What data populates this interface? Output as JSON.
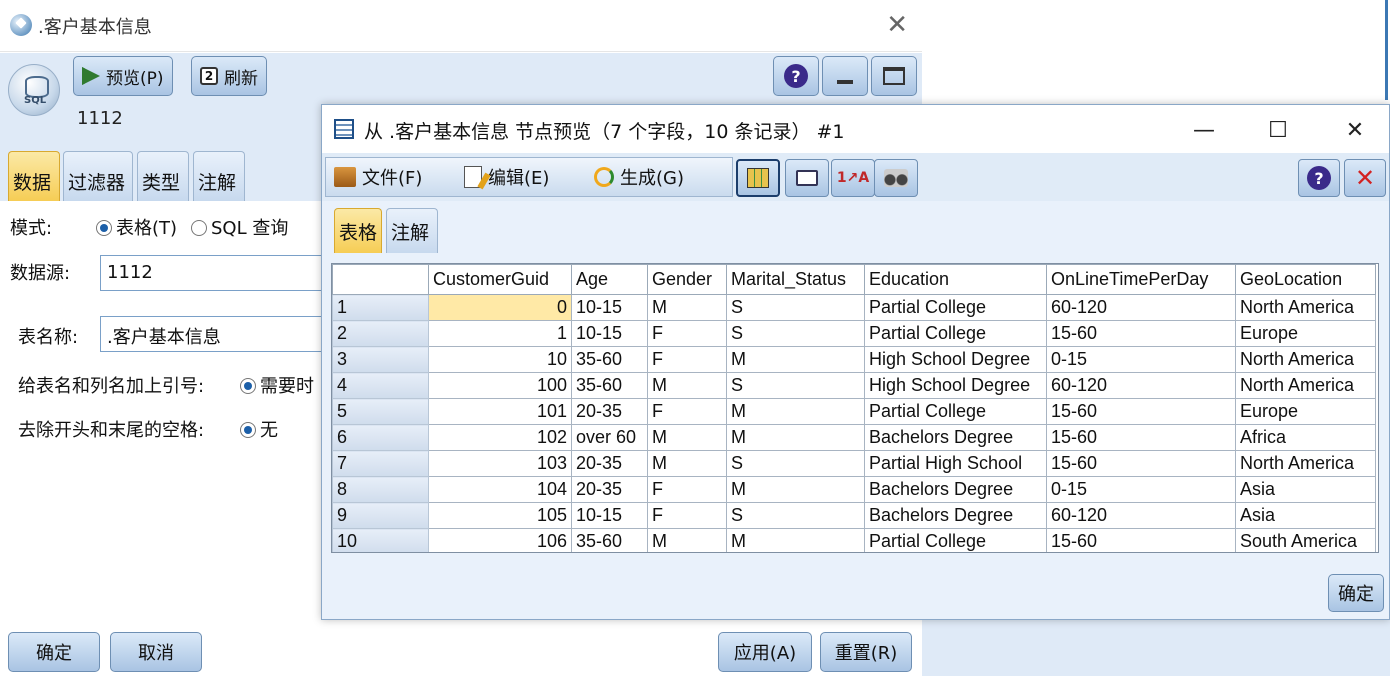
{
  "back_dialog": {
    "title": ".客户基本信息",
    "toolbar": {
      "preview_label": "预览(P)",
      "refresh_label": "刷新"
    },
    "source_name": "1112",
    "tabs": [
      "数据",
      "过滤器",
      "类型",
      "注解"
    ],
    "form": {
      "mode_label": "模式:",
      "mode_table": "表格(T)",
      "mode_sql": "SQL 查询",
      "datasource_label": "数据源:",
      "datasource_value": "1112",
      "tablename_label": "表名称:",
      "tablename_value": ".客户基本信息",
      "quote_label": "给表名和列名加上引号:",
      "quote_value": "需要时",
      "trim_label": "去除开头和末尾的空格:",
      "trim_value": "无"
    },
    "buttons": {
      "ok": "确定",
      "cancel": "取消",
      "apply": "应用(A)",
      "reset": "重置(R)"
    }
  },
  "preview": {
    "title": "从 .客户基本信息 节点预览（7 个字段，10 条记录） #1",
    "menu": {
      "file": "文件(F)",
      "edit": "编辑(E)",
      "generate": "生成(G)"
    },
    "tabs": [
      "表格",
      "注解"
    ],
    "ok_label": "确定",
    "columns": [
      "",
      "CustomerGuid",
      "Age",
      "Gender",
      "Marital_Status",
      "Education",
      "OnLineTimePerDay",
      "GeoLocation"
    ],
    "rows": [
      [
        "1",
        "0",
        "10-15",
        "M",
        "S",
        "Partial College",
        "60-120",
        "North America"
      ],
      [
        "2",
        "1",
        "10-15",
        "F",
        "S",
        "Partial College",
        "15-60",
        "Europe"
      ],
      [
        "3",
        "10",
        "35-60",
        "F",
        "M",
        "High School Degree",
        "0-15",
        "North America"
      ],
      [
        "4",
        "100",
        "35-60",
        "M",
        "S",
        "High School Degree",
        "60-120",
        "North America"
      ],
      [
        "5",
        "101",
        "20-35",
        "F",
        "M",
        "Partial College",
        "15-60",
        "Europe"
      ],
      [
        "6",
        "102",
        "over 60",
        "M",
        "M",
        "Bachelors Degree",
        "15-60",
        "Africa"
      ],
      [
        "7",
        "103",
        "20-35",
        "M",
        "S",
        "Partial High School",
        "15-60",
        "North America"
      ],
      [
        "8",
        "104",
        "20-35",
        "F",
        "M",
        "Bachelors Degree",
        "0-15",
        "Asia"
      ],
      [
        "9",
        "105",
        "10-15",
        "F",
        "S",
        "Bachelors Degree",
        "60-120",
        "Asia"
      ],
      [
        "10",
        "106",
        "35-60",
        "M",
        "M",
        "Partial College",
        "15-60",
        "South America"
      ]
    ]
  },
  "colors": {
    "accent_tab": "#f6cd55",
    "toolbar_bg": "#dfeaf7",
    "button_border": "#6e8fb3",
    "selected_cell": "#ffe9a6"
  }
}
